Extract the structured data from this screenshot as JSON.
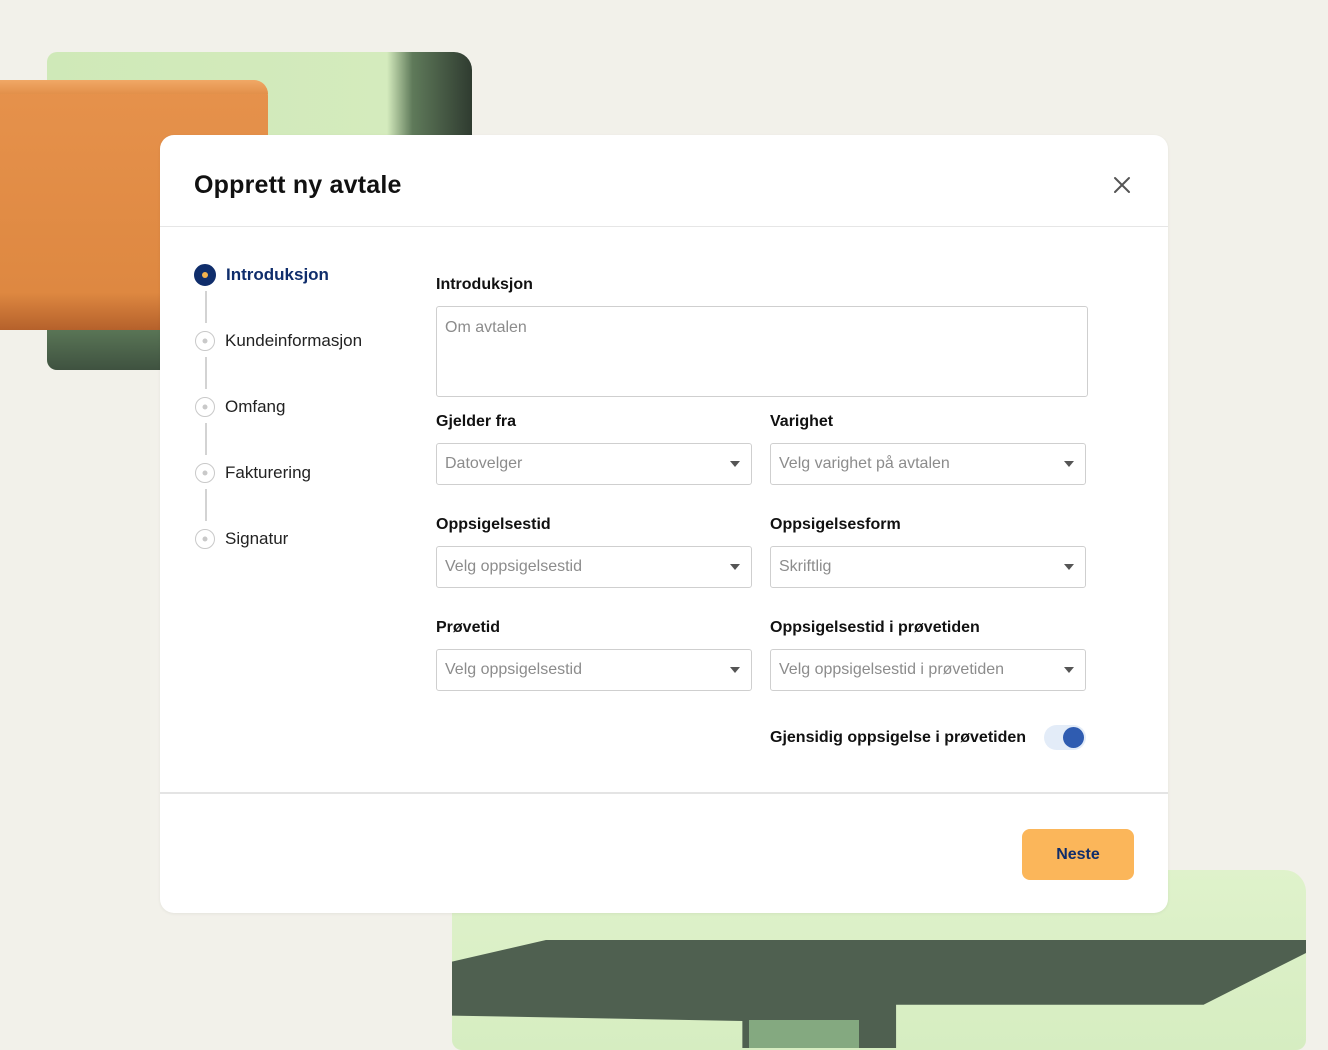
{
  "modal": {
    "title": "Opprett ny avtale",
    "close_icon": "close-icon"
  },
  "stepper": {
    "steps": [
      {
        "label": "Introduksjon",
        "state": "active"
      },
      {
        "label": "Kundeinformasjon",
        "state": "pending"
      },
      {
        "label": "Omfang",
        "state": "pending"
      },
      {
        "label": "Fakturering",
        "state": "pending"
      },
      {
        "label": "Signatur",
        "state": "pending"
      }
    ]
  },
  "form": {
    "introduction": {
      "label": "Introduksjon",
      "placeholder": "Om avtalen"
    },
    "valid_from": {
      "label": "Gjelder fra",
      "placeholder": "Datovelger"
    },
    "duration": {
      "label": "Varighet",
      "placeholder": "Velg varighet på avtalen"
    },
    "notice_period": {
      "label": "Oppsigelsestid",
      "placeholder": "Velg oppsigelsestid"
    },
    "notice_form": {
      "label": "Oppsigelsesform",
      "value": "Skriftlig"
    },
    "probation": {
      "label": "Prøvetid",
      "placeholder": "Velg oppsigelsestid"
    },
    "probation_notice": {
      "label": "Oppsigelsestid i prøvetiden",
      "placeholder": "Velg oppsigelsestid i prøvetiden"
    },
    "mutual_termination": {
      "label": "Gjensidig oppsigelse i prøvetiden",
      "enabled": true
    }
  },
  "footer": {
    "next_label": "Neste"
  },
  "colors": {
    "primary": "#0f2d6b",
    "accent": "#fbb65a",
    "toggle_on": "#2f5cb1",
    "background": "#f2f1ea"
  }
}
